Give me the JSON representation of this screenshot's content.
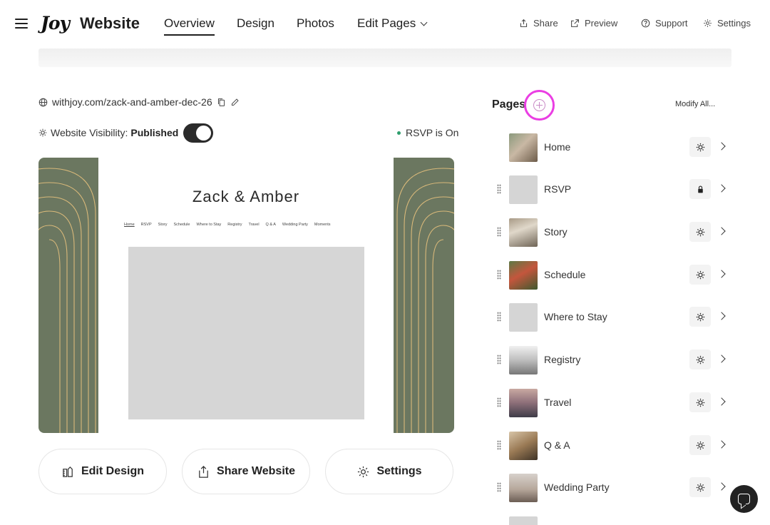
{
  "header": {
    "logo_text": "Joy",
    "title": "Website",
    "tabs": [
      {
        "label": "Overview",
        "active": true
      },
      {
        "label": "Design",
        "active": false
      },
      {
        "label": "Photos",
        "active": false
      },
      {
        "label": "Edit Pages",
        "active": false
      }
    ],
    "share_label": "Share",
    "preview_label": "Preview",
    "support_label": "Support",
    "settings_label": "Settings"
  },
  "site": {
    "url": "withjoy.com/zack-and-amber-dec-26",
    "visibility_label": "Website Visibility:",
    "visibility_value": "Published",
    "visibility_on": true,
    "rsvp_status": "RSVP is On",
    "rsvp_color": "#2f9e6e"
  },
  "preview": {
    "site_title": "Zack & Amber",
    "menu": [
      "Home",
      "RSVP",
      "Story",
      "Schedule",
      "Where to Stay",
      "Registry",
      "Travel",
      "Q & A",
      "Wedding Party",
      "Moments"
    ],
    "bg_color": "#6b7760",
    "accent_color": "#d9b97a"
  },
  "actions": {
    "edit_design": "Edit Design",
    "share_website": "Share Website",
    "settings": "Settings"
  },
  "pages_panel": {
    "heading": "Pages",
    "modify_all": "Modify All...",
    "highlight_color": "#ea3ee3",
    "pages": [
      {
        "name": "Home",
        "visibility_icon": "sun-icon"
      },
      {
        "name": "RSVP",
        "visibility_icon": "lock-icon"
      },
      {
        "name": "Story",
        "visibility_icon": "sun-icon"
      },
      {
        "name": "Schedule",
        "visibility_icon": "sun-icon"
      },
      {
        "name": "Where to Stay",
        "visibility_icon": "sun-icon"
      },
      {
        "name": "Registry",
        "visibility_icon": "sun-icon"
      },
      {
        "name": "Travel",
        "visibility_icon": "sun-icon"
      },
      {
        "name": "Q & A",
        "visibility_icon": "sun-icon"
      },
      {
        "name": "Wedding Party",
        "visibility_icon": "sun-icon"
      }
    ]
  }
}
